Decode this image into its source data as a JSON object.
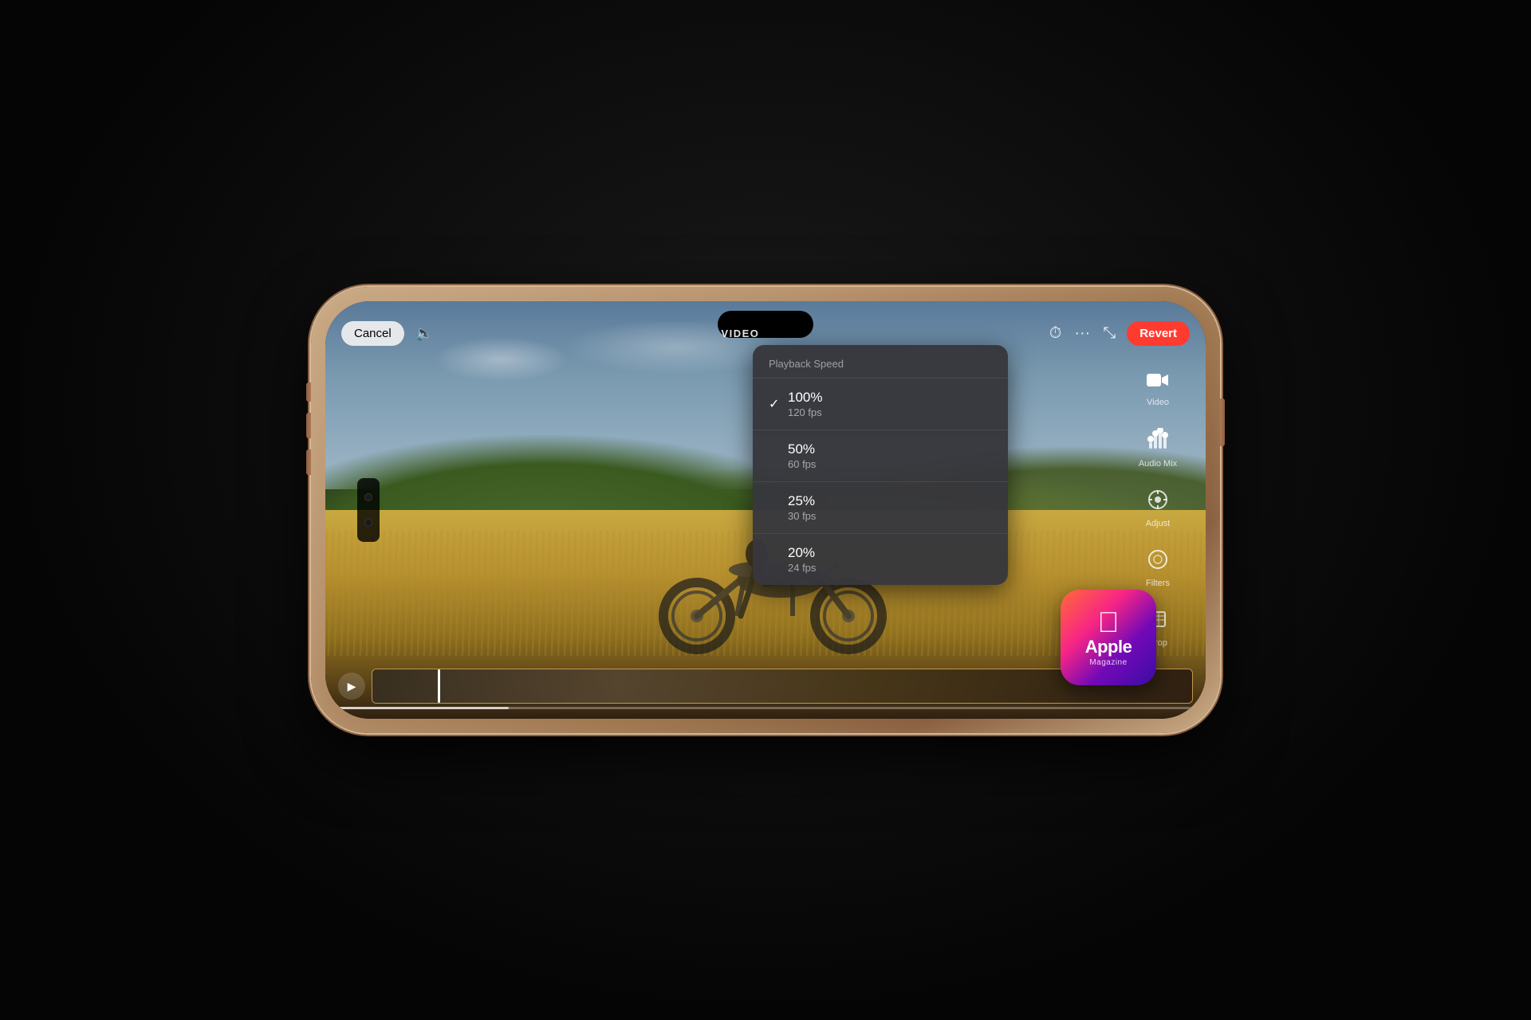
{
  "header": {
    "cancel_label": "Cancel",
    "title": "VIDEO",
    "revert_label": "Revert"
  },
  "playback_dropdown": {
    "title": "Playback Speed",
    "speeds": [
      {
        "percent": "100%",
        "fps": "120 fps",
        "selected": true
      },
      {
        "percent": "50%",
        "fps": "60 fps",
        "selected": false
      },
      {
        "percent": "25%",
        "fps": "30 fps",
        "selected": false
      },
      {
        "percent": "20%",
        "fps": "24 fps",
        "selected": false
      }
    ]
  },
  "sidebar": {
    "items": [
      {
        "id": "video",
        "label": "Video",
        "icon": "🎬",
        "active": true
      },
      {
        "id": "audio-mix",
        "label": "Audio Mix",
        "icon": "🎚"
      },
      {
        "id": "adjust",
        "label": "Adjust",
        "icon": "⚙️"
      },
      {
        "id": "filters",
        "label": "Filters",
        "icon": "⊙"
      },
      {
        "id": "crop",
        "label": "Crop",
        "icon": "⊞"
      }
    ]
  },
  "player": {
    "play_label": "▶"
  },
  "apple_magazine": {
    "name": "Apple",
    "sub": "Magazine"
  }
}
